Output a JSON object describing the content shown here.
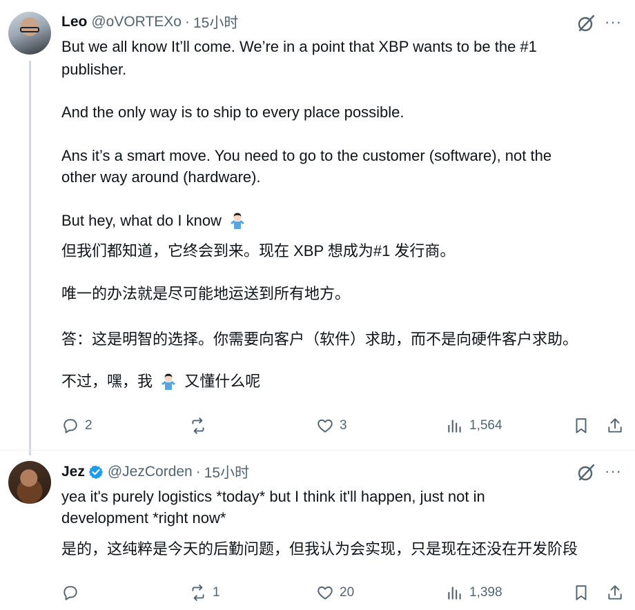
{
  "tweets": [
    {
      "name": "Leo",
      "handle": "@oVORTEXo",
      "dot": "·",
      "time": "15小时",
      "paragraphs": [
        "But we all know It’ll come. We’re in a point that XBP wants to be the #1",
        "publisher.",
        "And the only way is to ship to every place possible.",
        "Ans it’s a smart move. You need to go to the customer (software), not the",
        "other way around (hardware).",
        "But hey, what do I know",
        "但我们都知道，它终会到来。现在 XBP 想成为#1 发行商。",
        "唯一的办法就是尽可能地运送到所有地方。",
        "答：这是明智的选择。你需要向客户（软件）求助，而不是向硬件客户求助。",
        "不过，嘿，我",
        "又懂什么呢"
      ],
      "actions": {
        "replies": "2",
        "reposts": "",
        "likes": "3",
        "views": "1,564"
      }
    },
    {
      "name": "Jez",
      "handle": "@JezCorden",
      "dot": "·",
      "time": "15小时",
      "paragraphs": [
        "yea it's purely logistics *today* but I think it'll happen, just not in",
        "development *right now*",
        "是的，这纯粹是今天的后勤问题，但我认为会实现，只是现在还没在开发阶段"
      ],
      "actions": {
        "replies": "",
        "reposts": "1",
        "likes": "20",
        "views": "1,398"
      }
    }
  ],
  "icons": {
    "reply": "reply-icon",
    "repost": "repost-icon",
    "like": "like-icon",
    "views": "views-icon",
    "bookmark": "bookmark-icon",
    "share": "share-icon",
    "grok": "grok-icon",
    "more": "more-icon",
    "verified": "verified-badge-icon",
    "shrug": "person-shrugging-emoji"
  },
  "colors": {
    "text": "#0f1419",
    "secondary": "#536471",
    "verified": "#1d9bf0",
    "thread_line": "#cfd9de"
  }
}
